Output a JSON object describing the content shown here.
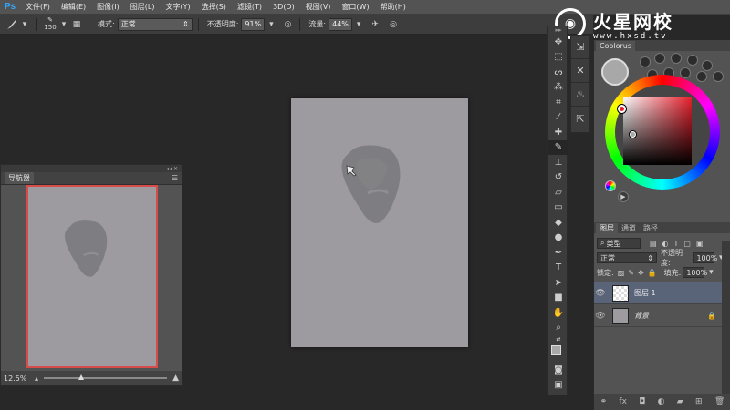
{
  "app": {
    "logo": "Ps"
  },
  "menu": [
    "文件(F)",
    "编辑(E)",
    "图像(I)",
    "图层(L)",
    "文字(Y)",
    "选择(S)",
    "滤镜(T)",
    "3D(D)",
    "视图(V)",
    "窗口(W)",
    "帮助(H)"
  ],
  "options": {
    "brush_size": "150",
    "mode_label": "模式:",
    "mode_value": "正常",
    "opacity_label": "不透明度:",
    "opacity_value": "91%",
    "flow_label": "流量:",
    "flow_value": "44%"
  },
  "watermark": {
    "title": "火星网校",
    "url": "www.hxsd.tv"
  },
  "navigator": {
    "tab": "导航器",
    "zoom": "12.5%"
  },
  "colour_panel": {
    "tab": "Coolorus",
    "wheel_hue": "#e8202d",
    "foreground": "#a8a8a8"
  },
  "layers": {
    "tabs": [
      "图层",
      "通道",
      "路径"
    ],
    "filter_label": "类型",
    "blend_mode": "正常",
    "opacity_label": "不透明度:",
    "opacity_value": "100%",
    "lock_label": "锁定:",
    "fill_label": "填充:",
    "fill_value": "100%",
    "items": [
      {
        "name": "图层 1",
        "selected": true
      },
      {
        "name": "背景",
        "locked": true
      }
    ]
  },
  "colors": {
    "canvas": "#9d9b9f",
    "blob": "#7e7d81",
    "ui_bg": "#282828",
    "panel": "#535353",
    "nav_border": "#d84b4b",
    "selected_layer": "#5a6478"
  }
}
